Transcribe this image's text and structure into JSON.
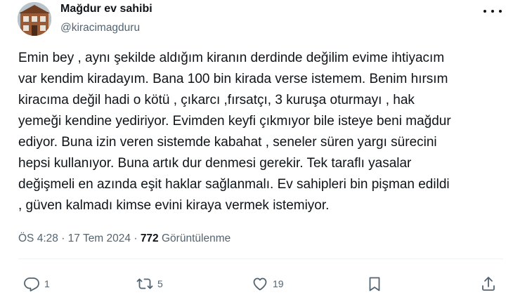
{
  "author": {
    "display_name": "Mağdur ev sahibi",
    "handle": "@kiracimagduru",
    "avatar_icon": "house-photo-avatar"
  },
  "tweet": {
    "text": "Emin bey , aynı şekilde aldığım kiranın derdinde değilim evime ihtiyacım\nvar kendim kiradayım. Bana 100 bin kirada verse istemem. Benim hırsım\nkiracıma değil hadi o kötü , çıkarcı ,fırsatçı,  3 kuruşa oturmayı , hak\nyemeği kendine yediriyor. Evimden keyfi çıkmıyor bile isteye beni mağdur\nediyor. Buna izin veren sistemde kabahat , seneler süren yargı sürecini\nhepsi kullanıyor. Buna artık dur denmesi gerekir. Tek taraflı yasalar\ndeğişmeli en azında eşit haklar sağlanmalı. Ev sahipleri bin pişman edildi\n, güven kalmadı kimse evini kiraya vermek istemiyor."
  },
  "meta": {
    "time": "ÖS 4:28",
    "separator": "·",
    "date": "17 Tem 2024",
    "views_count": "772",
    "views_label": "Görüntülenme"
  },
  "actions": {
    "reply": {
      "icon": "reply-icon",
      "count": "1"
    },
    "retweet": {
      "icon": "retweet-icon",
      "count": "5"
    },
    "like": {
      "icon": "heart-icon",
      "count": "19"
    },
    "bookmark": {
      "icon": "bookmark-icon",
      "count": ""
    },
    "share": {
      "icon": "share-icon",
      "count": ""
    }
  },
  "colors": {
    "text_primary": "#0f1419",
    "text_secondary": "#536471",
    "divider": "#eff3f4"
  }
}
